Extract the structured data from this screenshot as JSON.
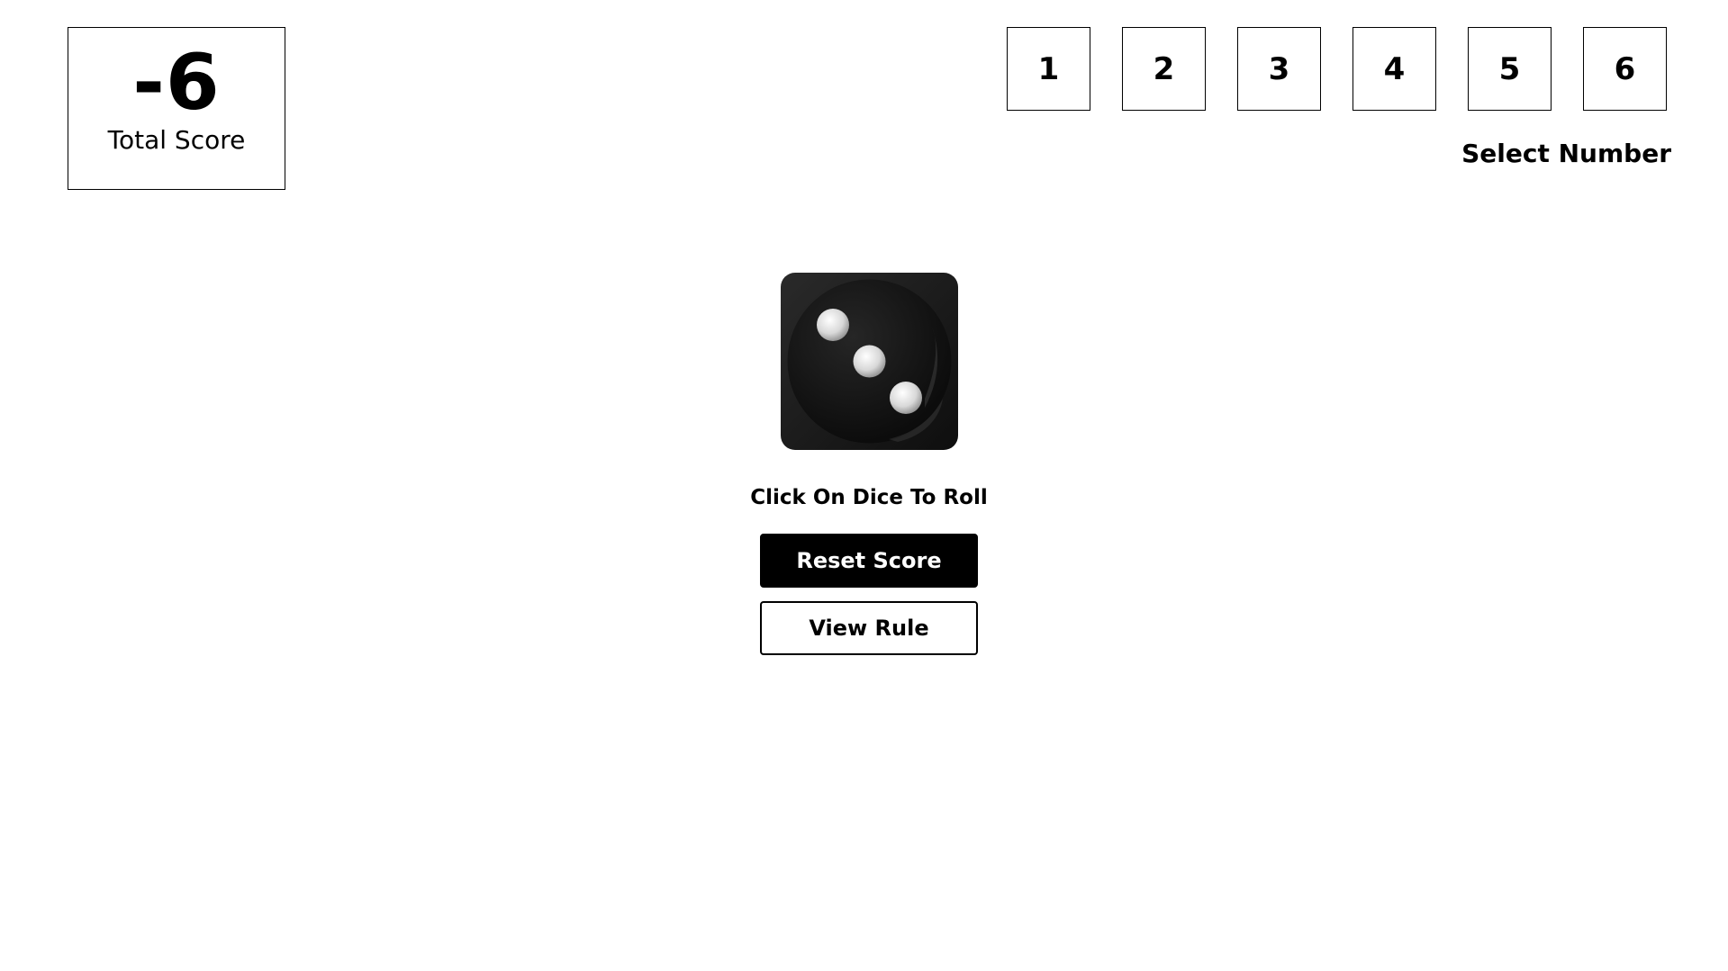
{
  "score": {
    "value": "-6",
    "label": "Total Score"
  },
  "number_options": [
    "1",
    "2",
    "3",
    "4",
    "5",
    "6"
  ],
  "select_label": "Select Number",
  "dice": {
    "face_value": 3,
    "icon": "dice-three-icon"
  },
  "roll_hint": "Click On Dice To Roll",
  "buttons": {
    "reset": "Reset Score",
    "rule": "View Rule"
  },
  "colors": {
    "dice_body": "#1b1b1b",
    "dice_pip": "#e8e8e8",
    "primary_button": "#000000"
  }
}
